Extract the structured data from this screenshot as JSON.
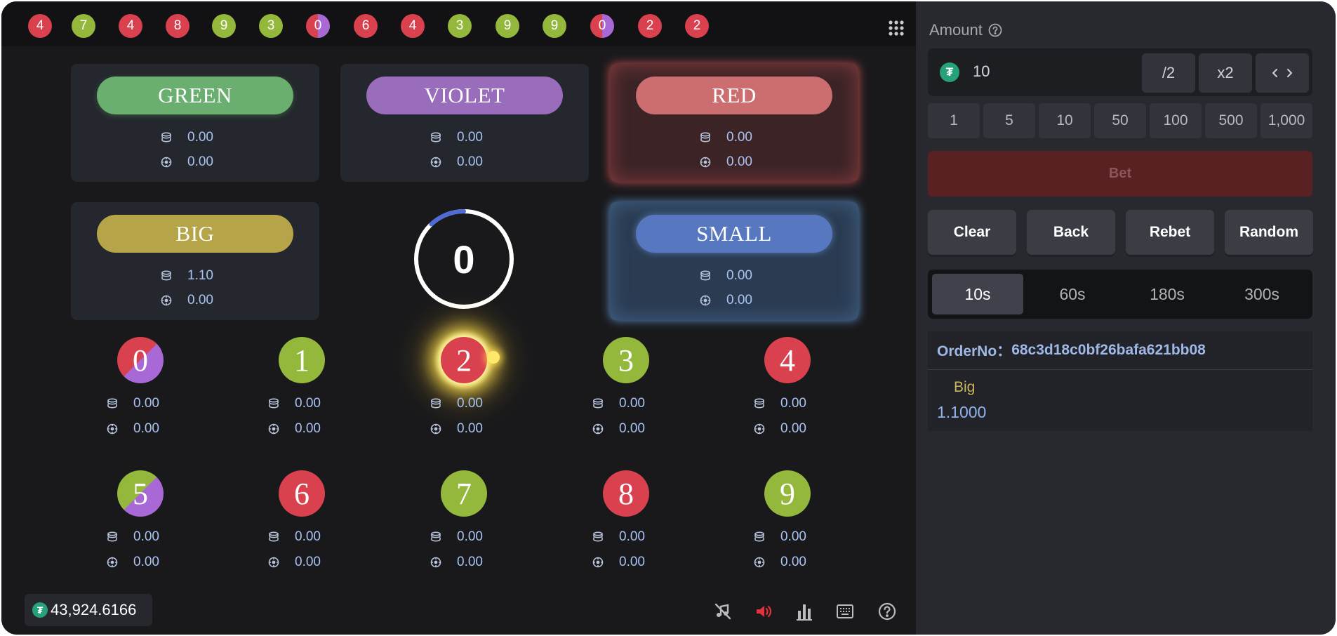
{
  "history": [
    {
      "n": "4",
      "c": "red"
    },
    {
      "n": "7",
      "c": "green"
    },
    {
      "n": "4",
      "c": "red"
    },
    {
      "n": "8",
      "c": "red"
    },
    {
      "n": "9",
      "c": "green"
    },
    {
      "n": "3",
      "c": "green"
    },
    {
      "n": "0",
      "c": "violet"
    },
    {
      "n": "6",
      "c": "red"
    },
    {
      "n": "4",
      "c": "red"
    },
    {
      "n": "3",
      "c": "green"
    },
    {
      "n": "9",
      "c": "green"
    },
    {
      "n": "9",
      "c": "green"
    },
    {
      "n": "0",
      "c": "violet"
    },
    {
      "n": "2",
      "c": "red"
    },
    {
      "n": "2",
      "c": "red"
    }
  ],
  "bets": {
    "green": {
      "label": "GREEN",
      "stake": "0.00",
      "payout": "0.00"
    },
    "violet": {
      "label": "VIOLET",
      "stake": "0.00",
      "payout": "0.00"
    },
    "red": {
      "label": "RED",
      "stake": "0.00",
      "payout": "0.00"
    },
    "big": {
      "label": "BIG",
      "stake": "1.10",
      "payout": "0.00"
    },
    "small": {
      "label": "SMALL",
      "stake": "0.00",
      "payout": "0.00"
    }
  },
  "timer": {
    "value": "0",
    "progress": 0.12
  },
  "numbers": [
    {
      "n": "0",
      "stake": "0.00",
      "payout": "0.00"
    },
    {
      "n": "1",
      "stake": "0.00",
      "payout": "0.00"
    },
    {
      "n": "2",
      "stake": "0.00",
      "payout": "0.00"
    },
    {
      "n": "3",
      "stake": "0.00",
      "payout": "0.00"
    },
    {
      "n": "4",
      "stake": "0.00",
      "payout": "0.00"
    },
    {
      "n": "5",
      "stake": "0.00",
      "payout": "0.00"
    },
    {
      "n": "6",
      "stake": "0.00",
      "payout": "0.00"
    },
    {
      "n": "7",
      "stake": "0.00",
      "payout": "0.00"
    },
    {
      "n": "8",
      "stake": "0.00",
      "payout": "0.00"
    },
    {
      "n": "9",
      "stake": "0.00",
      "payout": "0.00"
    }
  ],
  "balance": "43,924.6166",
  "side": {
    "amount_label": "Amount",
    "amount_value": "10",
    "half_label": "/2",
    "double_label": "x2",
    "chips": [
      "1",
      "5",
      "10",
      "50",
      "100",
      "500",
      "1,000"
    ],
    "bet_label": "Bet",
    "actions": {
      "clear": "Clear",
      "back": "Back",
      "rebet": "Rebet",
      "random": "Random"
    },
    "durations": [
      "10s",
      "60s",
      "180s",
      "300s"
    ],
    "active_duration": "10s",
    "order_label": "OrderNo：",
    "order_no": "68c3d18c0bf26bafa621bb08",
    "order_type": "Big",
    "order_odds": "1.1000"
  },
  "colors": {
    "red": "#d9414f",
    "green": "#93b83b",
    "violet": "#a869d6",
    "stat_text": "#a9c3f2",
    "tether": "#26a17b",
    "bet_button": "#5a2123",
    "timer_progress": "#4f6bd8"
  },
  "icons": [
    "grid-icon",
    "coins-icon",
    "chip-icon",
    "tether-icon",
    "help-icon",
    "music-off-icon",
    "speaker-icon",
    "stats-icon",
    "keyboard-icon",
    "arrows-icon"
  ]
}
